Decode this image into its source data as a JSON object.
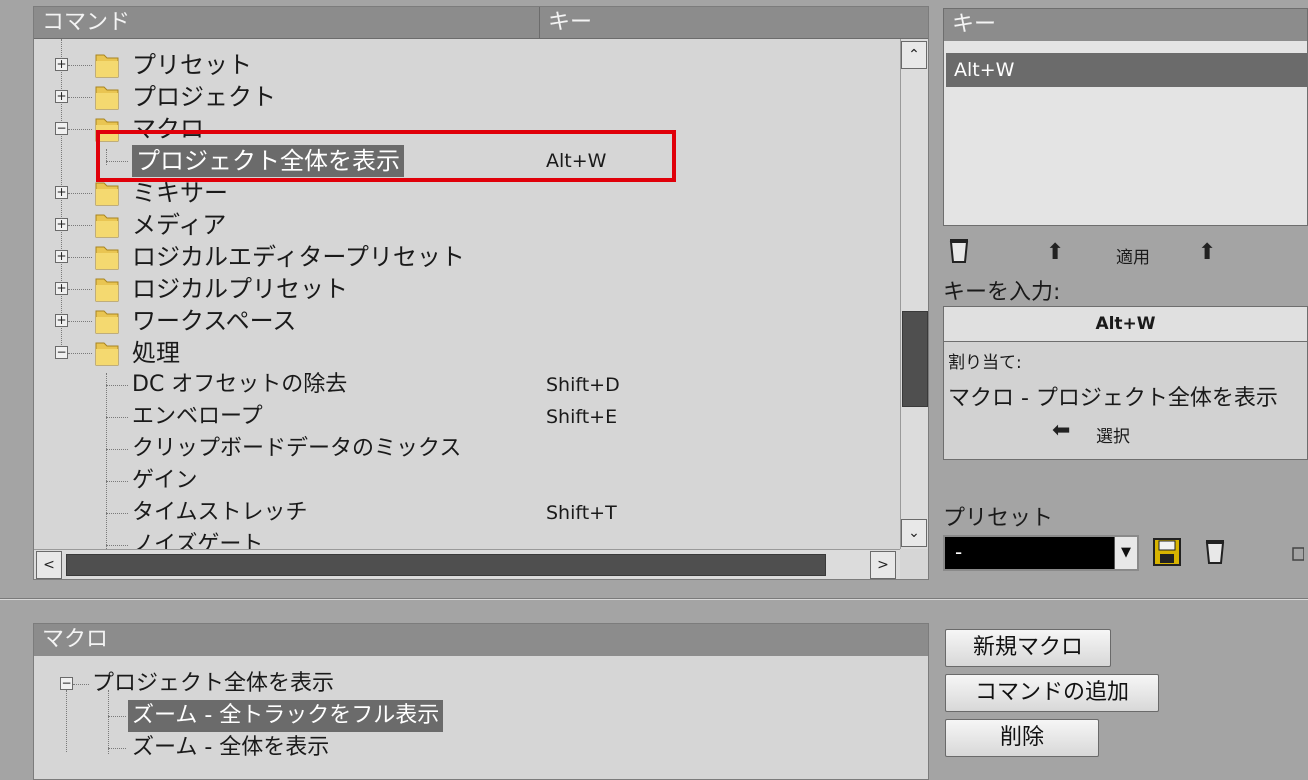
{
  "command_panel": {
    "header_command": "コマンド",
    "header_key": "キー",
    "rows": [
      {
        "type": "folder",
        "expanded": false,
        "label": "プリセット",
        "key": ""
      },
      {
        "type": "folder",
        "expanded": false,
        "label": "プロジェクト",
        "key": ""
      },
      {
        "type": "folder",
        "expanded": true,
        "label": "マクロ",
        "key": ""
      },
      {
        "type": "leaf",
        "selected": true,
        "label": "プロジェクト全体を表示",
        "key": "Alt+W"
      },
      {
        "type": "folder",
        "expanded": false,
        "label": "ミキサー",
        "key": ""
      },
      {
        "type": "folder",
        "expanded": false,
        "label": "メディア",
        "key": ""
      },
      {
        "type": "folder",
        "expanded": false,
        "label": "ロジカルエディタープリセット",
        "key": ""
      },
      {
        "type": "folder",
        "expanded": false,
        "label": "ロジカルプリセット",
        "key": ""
      },
      {
        "type": "folder",
        "expanded": false,
        "label": "ワークスペース",
        "key": ""
      },
      {
        "type": "folder",
        "expanded": true,
        "label": "処理",
        "key": ""
      },
      {
        "type": "leaf",
        "label": "DC オフセットの除去",
        "key": "Shift+D"
      },
      {
        "type": "leaf",
        "label": "エンベロープ",
        "key": "Shift+E"
      },
      {
        "type": "leaf",
        "label": "クリップボードデータのミックス",
        "key": ""
      },
      {
        "type": "leaf",
        "label": "ゲイン",
        "key": ""
      },
      {
        "type": "leaf",
        "label": "タイムストレッチ",
        "key": "Shift+T"
      },
      {
        "type": "leaf",
        "label": "ノイズゲート",
        "key": ""
      }
    ]
  },
  "key_panel": {
    "header": "キー",
    "selected_key": "Alt+W",
    "apply_label": "適用",
    "enter_key_label": "キーを入力:",
    "entered_key": "Alt+W",
    "assigned_label": "割り当て:",
    "assigned_value": "マクロ - プロジェクト全体を表示",
    "select_label": "選択"
  },
  "preset": {
    "label": "プリセット",
    "value": "-"
  },
  "macro_panel": {
    "header": "マクロ",
    "root": "プロジェクト全体を表示",
    "items": [
      {
        "label": "ズーム - 全トラックをフル表示",
        "selected": true
      },
      {
        "label": "ズーム - 全体を表示",
        "selected": false
      }
    ]
  },
  "buttons": {
    "new_macro": "新規マクロ",
    "add_command": "コマンドの追加",
    "delete": "削除"
  },
  "colors": {
    "highlight_box": "#e0000a",
    "selection_bg": "#6b6b6b"
  }
}
